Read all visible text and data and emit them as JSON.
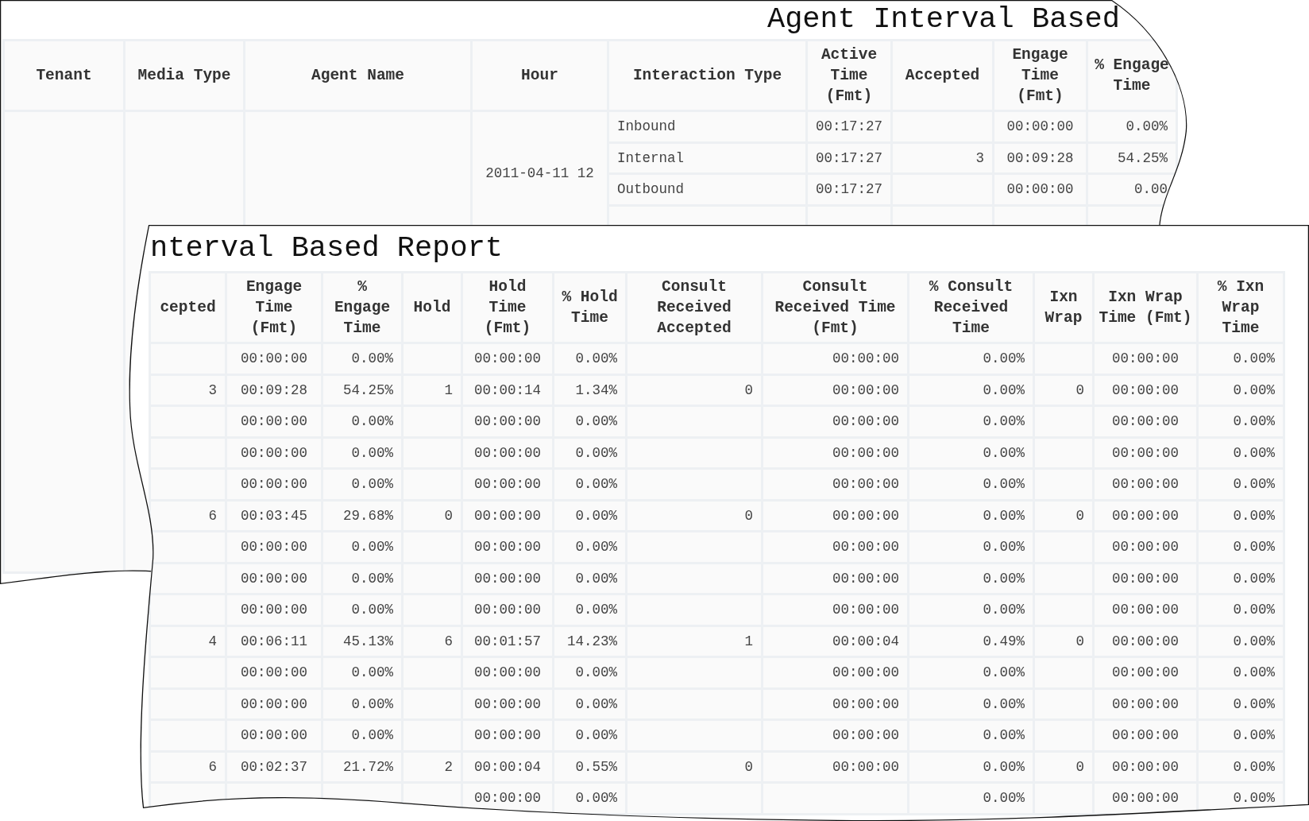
{
  "top_report": {
    "title": "Agent Interval Based",
    "columns": [
      "Tenant",
      "Media Type",
      "Agent Name",
      "Hour",
      "Interaction Type",
      "Active Time (Fmt)",
      "Accepted",
      "Engage Time (Fmt)",
      "% Engage Time"
    ],
    "rows": [
      [
        {
          "text": "",
          "rowspan": 4
        },
        {
          "text": "",
          "rowspan": 4
        },
        {
          "text": "",
          "rowspan": 4
        },
        {
          "text": "2011-04-11 12",
          "rowspan": 4
        },
        "Inbound",
        "00:17:27",
        "",
        "00:00:00",
        "0.00%"
      ],
      [
        "Internal",
        "00:17:27",
        "3",
        "00:09:28",
        "54.25%"
      ],
      [
        "Outbound",
        "00:17:27",
        "",
        "00:00:00",
        "0.00"
      ],
      [
        "",
        "",
        "",
        "",
        ""
      ]
    ]
  },
  "bottom_report": {
    "title": "nterval Based Report",
    "columns": [
      "cepted",
      "Engage Time (Fmt)",
      "% Engage Time",
      "Hold",
      "Hold Time (Fmt)",
      "% Hold Time",
      "Consult Received Accepted",
      "Consult Received Time (Fmt)",
      "% Consult Received Time",
      "Ixn Wrap",
      "Ixn Wrap Time (Fmt)",
      "% Ixn Wrap Time"
    ],
    "rows": [
      [
        null,
        "00:00:00",
        "0.00%",
        null,
        "00:00:00",
        "0.00%",
        null,
        "00:00:00",
        "0.00%",
        null,
        "00:00:00",
        "0.00%"
      ],
      [
        "3",
        "00:09:28",
        "54.25%",
        "1",
        "00:00:14",
        "1.34%",
        "0",
        "00:00:00",
        "0.00%",
        "0",
        "00:00:00",
        "0.00%"
      ],
      [
        null,
        "00:00:00",
        "0.00%",
        null,
        "00:00:00",
        "0.00%",
        null,
        "00:00:00",
        "0.00%",
        null,
        "00:00:00",
        "0.00%"
      ],
      [
        null,
        "00:00:00",
        "0.00%",
        null,
        "00:00:00",
        "0.00%",
        null,
        "00:00:00",
        "0.00%",
        null,
        "00:00:00",
        "0.00%"
      ],
      [
        null,
        "00:00:00",
        "0.00%",
        null,
        "00:00:00",
        "0.00%",
        null,
        "00:00:00",
        "0.00%",
        null,
        "00:00:00",
        "0.00%"
      ],
      [
        "6",
        "00:03:45",
        "29.68%",
        "0",
        "00:00:00",
        "0.00%",
        "0",
        "00:00:00",
        "0.00%",
        "0",
        "00:00:00",
        "0.00%"
      ],
      [
        null,
        "00:00:00",
        "0.00%",
        null,
        "00:00:00",
        "0.00%",
        null,
        "00:00:00",
        "0.00%",
        null,
        "00:00:00",
        "0.00%"
      ],
      [
        null,
        "00:00:00",
        "0.00%",
        null,
        "00:00:00",
        "0.00%",
        null,
        "00:00:00",
        "0.00%",
        null,
        "00:00:00",
        "0.00%"
      ],
      [
        null,
        "00:00:00",
        "0.00%",
        null,
        "00:00:00",
        "0.00%",
        null,
        "00:00:00",
        "0.00%",
        null,
        "00:00:00",
        "0.00%"
      ],
      [
        "4",
        "00:06:11",
        "45.13%",
        "6",
        "00:01:57",
        "14.23%",
        "1",
        "00:00:04",
        "0.49%",
        "0",
        "00:00:00",
        "0.00%"
      ],
      [
        null,
        "00:00:00",
        "0.00%",
        null,
        "00:00:00",
        "0.00%",
        null,
        "00:00:00",
        "0.00%",
        null,
        "00:00:00",
        "0.00%"
      ],
      [
        null,
        "00:00:00",
        "0.00%",
        null,
        "00:00:00",
        "0.00%",
        null,
        "00:00:00",
        "0.00%",
        null,
        "00:00:00",
        "0.00%"
      ],
      [
        null,
        "00:00:00",
        "0.00%",
        null,
        "00:00:00",
        "0.00%",
        null,
        "00:00:00",
        "0.00%",
        null,
        "00:00:00",
        "0.00%"
      ],
      [
        "6",
        "00:02:37",
        "21.72%",
        "2",
        "00:00:04",
        "0.55%",
        "0",
        "00:00:00",
        "0.00%",
        "0",
        "00:00:00",
        "0.00%"
      ],
      [
        null,
        null,
        null,
        null,
        "00:00:00",
        "0.00%",
        null,
        null,
        "0.00%",
        null,
        "00:00:00",
        "0.00%"
      ]
    ]
  }
}
